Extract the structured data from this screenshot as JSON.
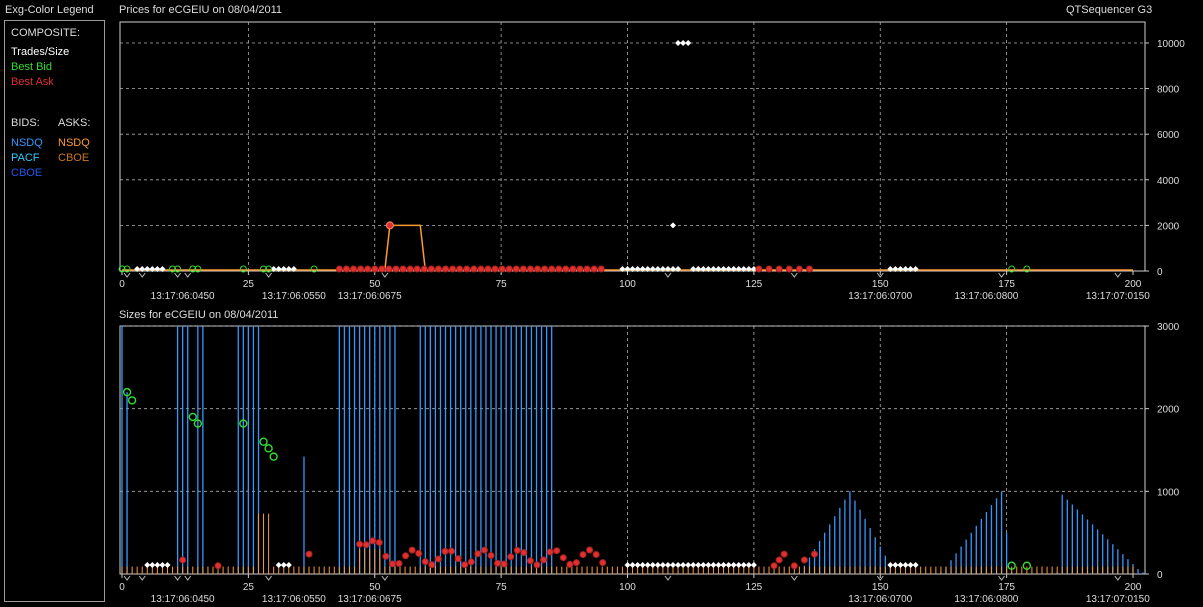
{
  "header": {
    "legend_title": "Exg-Color Legend",
    "top_title": "Prices for  eCGEIU  on  08/04/2011",
    "app_name": "QTSequencer G3",
    "bottom_title": "Sizes for  eCGEIU  on  08/04/2011"
  },
  "legend": {
    "composite_heading": "COMPOSITE:",
    "trades": "Trades/Size",
    "best_bid": "Best Bid",
    "best_ask": "Best Ask",
    "bids_heading": "BIDS:",
    "asks_heading": "ASKS:",
    "bids": [
      "NSDQ",
      "PACF",
      "CBOE"
    ],
    "asks": [
      "NSDQ",
      "CBOE"
    ]
  },
  "colors": {
    "trades": "#ffffff",
    "best_bid": "#33dd33",
    "best_ask": "#e03030",
    "bid_nsdq": "#3399ff",
    "bid_pacf": "#33ccff",
    "bid_cboe": "#2255ee",
    "ask_nsdq": "#ff9933",
    "ask_cboe": "#cc7722",
    "grid": "#b0b0b0"
  },
  "chart_data": [
    {
      "type": "line",
      "title": "Prices for  eCGEIU  on  08/04/2011",
      "xlim": [
        0,
        200
      ],
      "ylim": [
        0,
        11000
      ],
      "x_ticks": [
        0,
        25,
        50,
        75,
        100,
        125,
        150,
        175,
        200
      ],
      "y_ticks": [
        0,
        2000,
        4000,
        6000,
        8000,
        10000
      ],
      "time_labels": [
        {
          "x": 12,
          "label": "13:17:06:0450"
        },
        {
          "x": 34,
          "label": "13:17:06:0550"
        },
        {
          "x": 49,
          "label": "13:17:06:0675"
        },
        {
          "x": 150,
          "label": "13:17:06:0700"
        },
        {
          "x": 171,
          "label": "13:17:06:0800"
        },
        {
          "x": 197,
          "label": "13:17:07:0150"
        }
      ],
      "grid": true,
      "series": [
        {
          "name": "Best Ask",
          "points": [
            [
              53,
              2000
            ],
            [
              59,
              2000
            ]
          ]
        },
        {
          "name": "Trades/Size",
          "points": [
            [
              110,
              10000
            ],
            [
              111,
              10000
            ],
            [
              112,
              10000
            ],
            [
              109,
              2000
            ]
          ]
        }
      ]
    },
    {
      "type": "bar",
      "title": "Sizes for  eCGEIU  on  08/04/2011",
      "xlim": [
        0,
        200
      ],
      "ylim": [
        0,
        3000
      ],
      "x_ticks": [
        0,
        25,
        50,
        75,
        100,
        125,
        150,
        175,
        200
      ],
      "y_ticks": [
        0,
        1000,
        2000,
        3000
      ],
      "time_labels": [
        {
          "x": 12,
          "label": "13:17:06:0450"
        },
        {
          "x": 34,
          "label": "13:17:06:0550"
        },
        {
          "x": 49,
          "label": "13:17:06:0675"
        },
        {
          "x": 150,
          "label": "13:17:06:0700"
        },
        {
          "x": 171,
          "label": "13:17:06:0800"
        },
        {
          "x": 197,
          "label": "13:17:07:0150"
        }
      ],
      "grid": true,
      "best_bid_sizes": [
        [
          1,
          2200
        ],
        [
          2,
          2100
        ],
        [
          14,
          1900
        ],
        [
          15,
          1820
        ],
        [
          24,
          1820
        ],
        [
          28,
          1600
        ],
        [
          29,
          1520
        ],
        [
          30,
          1420
        ],
        [
          176,
          100
        ],
        [
          179,
          100
        ]
      ]
    }
  ]
}
